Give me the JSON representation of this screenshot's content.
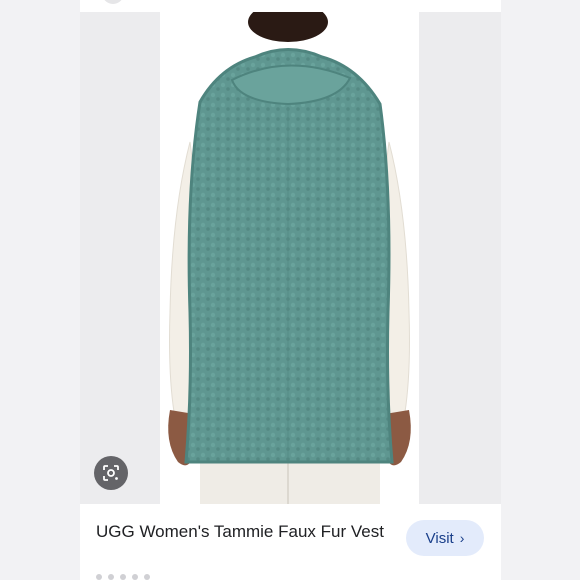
{
  "result_card": {
    "title": "UGG Women's Tammie Faux Fur Vest",
    "visit_label": "Visit",
    "visit_icon": "chevron-right-icon",
    "lens_icon": "google-lens-icon"
  },
  "colors": {
    "vest": "#5f9791",
    "vest_shade": "#4e847e",
    "sleeve": "#f3efe7",
    "skin": "#8c5a43",
    "hair": "#2a1a14",
    "accent_button": "#e3ebfb",
    "accent_text": "#1a3f8a"
  }
}
